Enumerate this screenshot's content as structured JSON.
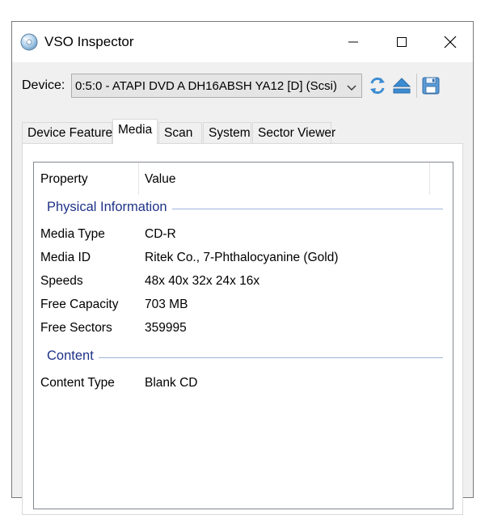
{
  "window": {
    "title": "VSO Inspector"
  },
  "device": {
    "label": "Device:",
    "selected": "0:5:0 - ATAPI DVD A  DH16ABSH YA12 [D] (Scsi)"
  },
  "tabs": [
    {
      "label": "Device Features",
      "active": false
    },
    {
      "label": "Media",
      "active": true
    },
    {
      "label": "Scan",
      "active": false
    },
    {
      "label": "System",
      "active": false
    },
    {
      "label": "Sector Viewer",
      "active": false
    }
  ],
  "list": {
    "columns": [
      "Property",
      "Value"
    ],
    "groups": [
      {
        "title": "Physical Information",
        "rows": [
          {
            "property": "Media Type",
            "value": "CD-R"
          },
          {
            "property": "Media ID",
            "value": "Ritek Co., 7-Phthalocyanine (Gold)"
          },
          {
            "property": "Speeds",
            "value": "48x 40x 32x 24x 16x"
          },
          {
            "property": "Free Capacity",
            "value": "703 MB"
          },
          {
            "property": "Free Sectors",
            "value": "359995"
          }
        ]
      },
      {
        "title": "Content",
        "rows": [
          {
            "property": "Content Type",
            "value": "Blank CD"
          }
        ]
      }
    ]
  },
  "icons": {
    "app": "disc-icon",
    "refresh": "refresh-icon",
    "eject": "eject-icon",
    "save": "save-icon"
  },
  "colors": {
    "group_header": "#1e3287",
    "accent_blue": "#3c8cd2"
  }
}
